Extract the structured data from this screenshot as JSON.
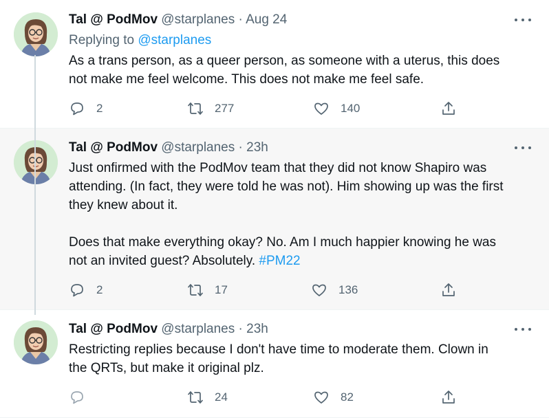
{
  "colors": {
    "accent": "#1d9bf0",
    "muted": "#536471",
    "text": "#0f1419",
    "highlight_bg": "#f7f7f7"
  },
  "tweets": [
    {
      "name": "Tal @ PodMov",
      "handle": "@starplanes",
      "separator": "·",
      "time": "Aug 24",
      "replying_prefix": "Replying to",
      "replying_to": "@starplanes",
      "text": "As a trans person, as a queer person, as someone with a uterus, this does\nnot make me feel welcome. This does not make me feel safe.",
      "replies": "2",
      "retweets": "277",
      "likes": "140",
      "icons": {
        "reply": "reply-icon",
        "retweet": "retweet-icon",
        "like": "like-icon",
        "share": "share-icon",
        "more": "more-icon"
      }
    },
    {
      "name": "Tal @ PodMov",
      "handle": "@starplanes",
      "separator": "·",
      "time": "23h",
      "text": "Just onfirmed with the PodMov team that they did not know Shapiro was\nattending. (In fact, they were told he was not). Him showing up was the first\nthey knew about it.\n\nDoes that make everything okay? No. Am I much happier knowing he was\nnot an invited guest? Absolutely. ",
      "hashtag": "#PM22",
      "replies": "2",
      "retweets": "17",
      "likes": "136"
    },
    {
      "name": "Tal @ PodMov",
      "handle": "@starplanes",
      "separator": "·",
      "time": "23h",
      "text": "Restricting replies because I don't have time to moderate them. Clown in\nthe QRTs, but make it original plz.",
      "retweets": "24",
      "likes": "82"
    }
  ]
}
